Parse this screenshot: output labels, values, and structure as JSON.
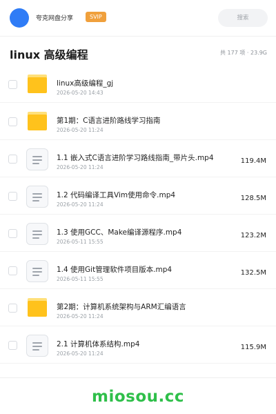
{
  "header": {
    "app_name": "夸克网盘分享",
    "badge": "SVIP",
    "search_label": "搜索"
  },
  "folder": {
    "title": "linux 高级编程",
    "meta": "共 177 项 · 23.9G"
  },
  "items": [
    {
      "type": "folder",
      "name": "linux高级编程_gj",
      "date": "2026-05-20 14:43",
      "size": ""
    },
    {
      "type": "folder",
      "name": "第1期：C语言进阶路线学习指南",
      "date": "2026-05-20 11:24",
      "size": ""
    },
    {
      "type": "file",
      "name": "1.1 嵌入式C语言进阶学习路线指南_带片头.mp4",
      "date": "2026-05-20 11:24",
      "size": "119.4M"
    },
    {
      "type": "file",
      "name": "1.2 代码编译工具Vim使用命令.mp4",
      "date": "2026-05-20 11:24",
      "size": "128.5M"
    },
    {
      "type": "file",
      "name": "1.3 使用GCC、Make编译源程序.mp4",
      "date": "2026-05-11 15:55",
      "size": "123.2M"
    },
    {
      "type": "file",
      "name": "1.4 使用Git管理软件项目版本.mp4",
      "date": "2026-05-11 15:55",
      "size": "132.5M"
    },
    {
      "type": "folder",
      "name": "第2期：计算机系统架构与ARM汇编语言",
      "date": "2026-05-20 11:24",
      "size": ""
    },
    {
      "type": "file",
      "name": "2.1 计算机体系结构.mp4",
      "date": "2026-05-20 11:24",
      "size": "115.9M"
    }
  ],
  "watermark": "miosou.cc",
  "colors": {
    "accent": "#2f7cf6",
    "badge": "#f0a03c",
    "folder": "#ffc21c",
    "watermark": "#2fbf4a"
  },
  "icons": {
    "folder": "folder-icon",
    "file": "document-icon"
  }
}
